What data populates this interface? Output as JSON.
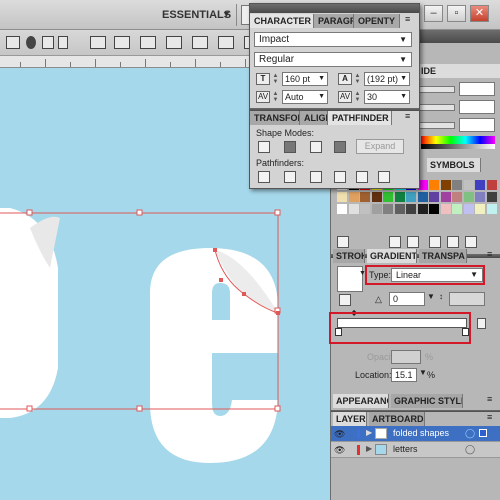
{
  "workspace": {
    "label": "ESSENTIALS",
    "arrow": "▼"
  },
  "window_controls": {
    "minimize": "–",
    "restore": "▫",
    "close": "✕"
  },
  "character_panel": {
    "tabs": [
      "CHARACTER",
      "PARAGR",
      "OPENTY"
    ],
    "menu": "≡",
    "font_family": "Impact",
    "font_style": "Regular",
    "font_size": "160 pt",
    "leading": "(192 pt)",
    "kerning": "Auto",
    "tracking": "30"
  },
  "pathfinder_panel": {
    "tabs": [
      "TRANSFOR",
      "ALIGN",
      "PATHFINDER"
    ],
    "shape_modes_label": "Shape Modes:",
    "expand_label": "Expand",
    "pathfinders_label": "Pathfinders:"
  },
  "color_panel": {
    "tab": "IDE"
  },
  "swatches_panel": {
    "tab": "SYMBOLS"
  },
  "gradient_panel": {
    "tabs": [
      "STROKE",
      "GRADIENT",
      "TRANSPA"
    ],
    "type_label": "Type:",
    "type_value": "Linear",
    "angle_value": "0",
    "opacity_label": "Opacity:",
    "opacity_unit": "%",
    "location_label": "Location:",
    "location_value": "15.1",
    "location_unit": "%"
  },
  "appearance_panel": {
    "tabs": [
      "APPEARANCE",
      "GRAPHIC STYLES"
    ]
  },
  "layers_panel": {
    "tabs": [
      "LAYERS",
      "ARTBOARDS"
    ],
    "layers": [
      {
        "name": "folded shapes",
        "color": "#3f6fd8",
        "selected": true
      },
      {
        "name": "letters",
        "color": "#e03030",
        "selected": false
      }
    ]
  },
  "colors": {
    "canvas_bg": "#a5d8ea",
    "highlight_box": "#d3182a",
    "selection_path": "#e05858",
    "layer_selected": "#3d6fc3"
  }
}
